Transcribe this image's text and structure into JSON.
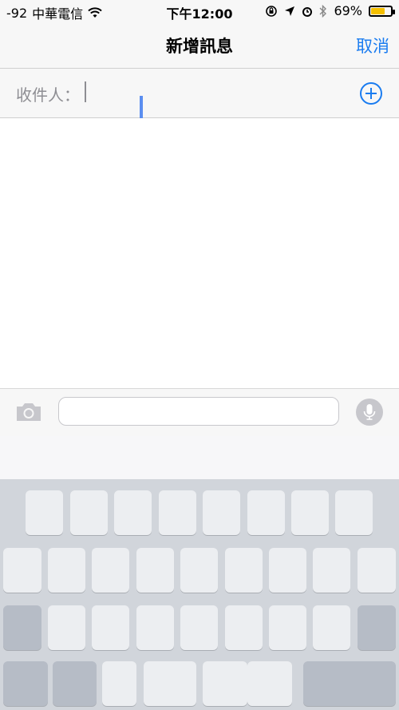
{
  "status_bar": {
    "signal": "-92",
    "carrier": "中華電信",
    "time": "下午12:00",
    "battery_percent_label": "69%",
    "battery_level": 0.69
  },
  "nav": {
    "title": "新增訊息",
    "cancel_label": "取消"
  },
  "recipient": {
    "label": "收件人："
  },
  "compose": {
    "input_value": "",
    "input_placeholder": ""
  },
  "colors": {
    "accent": "#1a7cf0",
    "battery": "#f5c000",
    "keyboard_bg": "#d1d5db"
  }
}
